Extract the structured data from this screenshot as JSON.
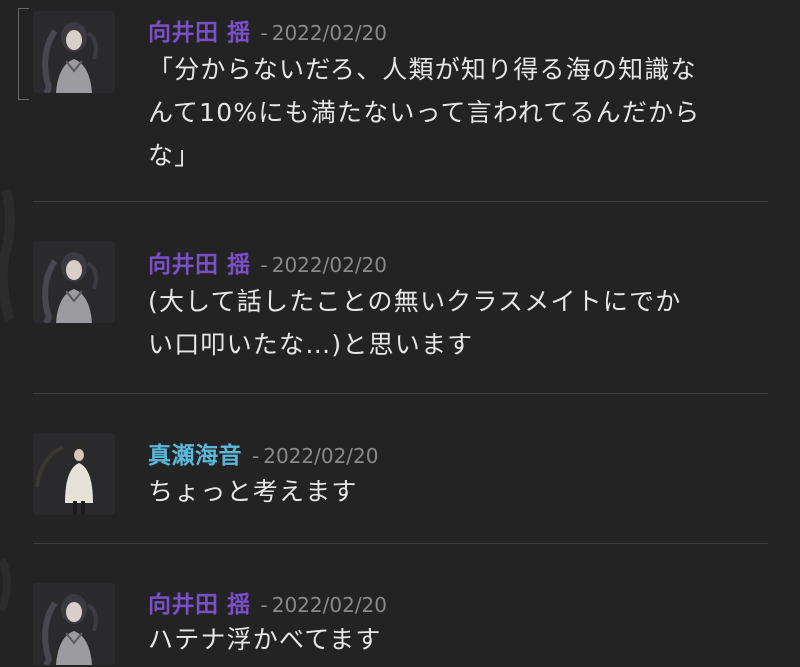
{
  "colors": {
    "background": "#232323",
    "name_purple": "#7b4fc8",
    "name_cyan": "#5ab7d9",
    "timestamp": "#8a8a8a",
    "message_text": "#e6e6e6"
  },
  "messages": [
    {
      "author": "向井田 揺",
      "separator": "-",
      "date": "2022/02/20",
      "lines": [
        "「分からないだろ、人類が知り得る海の知識な",
        "んて10%にも満たないって言われてるんだから",
        "な」"
      ],
      "avatar_icon": "character-avatar-icon"
    },
    {
      "author": "向井田 揺",
      "separator": "-",
      "date": "2022/02/20",
      "lines": [
        "(大して話したことの無いクラスメイトにでか",
        "い口叩いたな…)と思います"
      ],
      "avatar_icon": "character-avatar-icon"
    },
    {
      "author": "真瀬海音",
      "separator": "-",
      "date": "2022/02/20",
      "lines": [
        "ちょっと考えます"
      ],
      "avatar_icon": "character-avatar-icon"
    },
    {
      "author": "向井田 揺",
      "separator": "-",
      "date": "2022/02/20",
      "lines": [
        "ハテナ浮かべてます"
      ],
      "avatar_icon": "character-avatar-icon"
    }
  ]
}
